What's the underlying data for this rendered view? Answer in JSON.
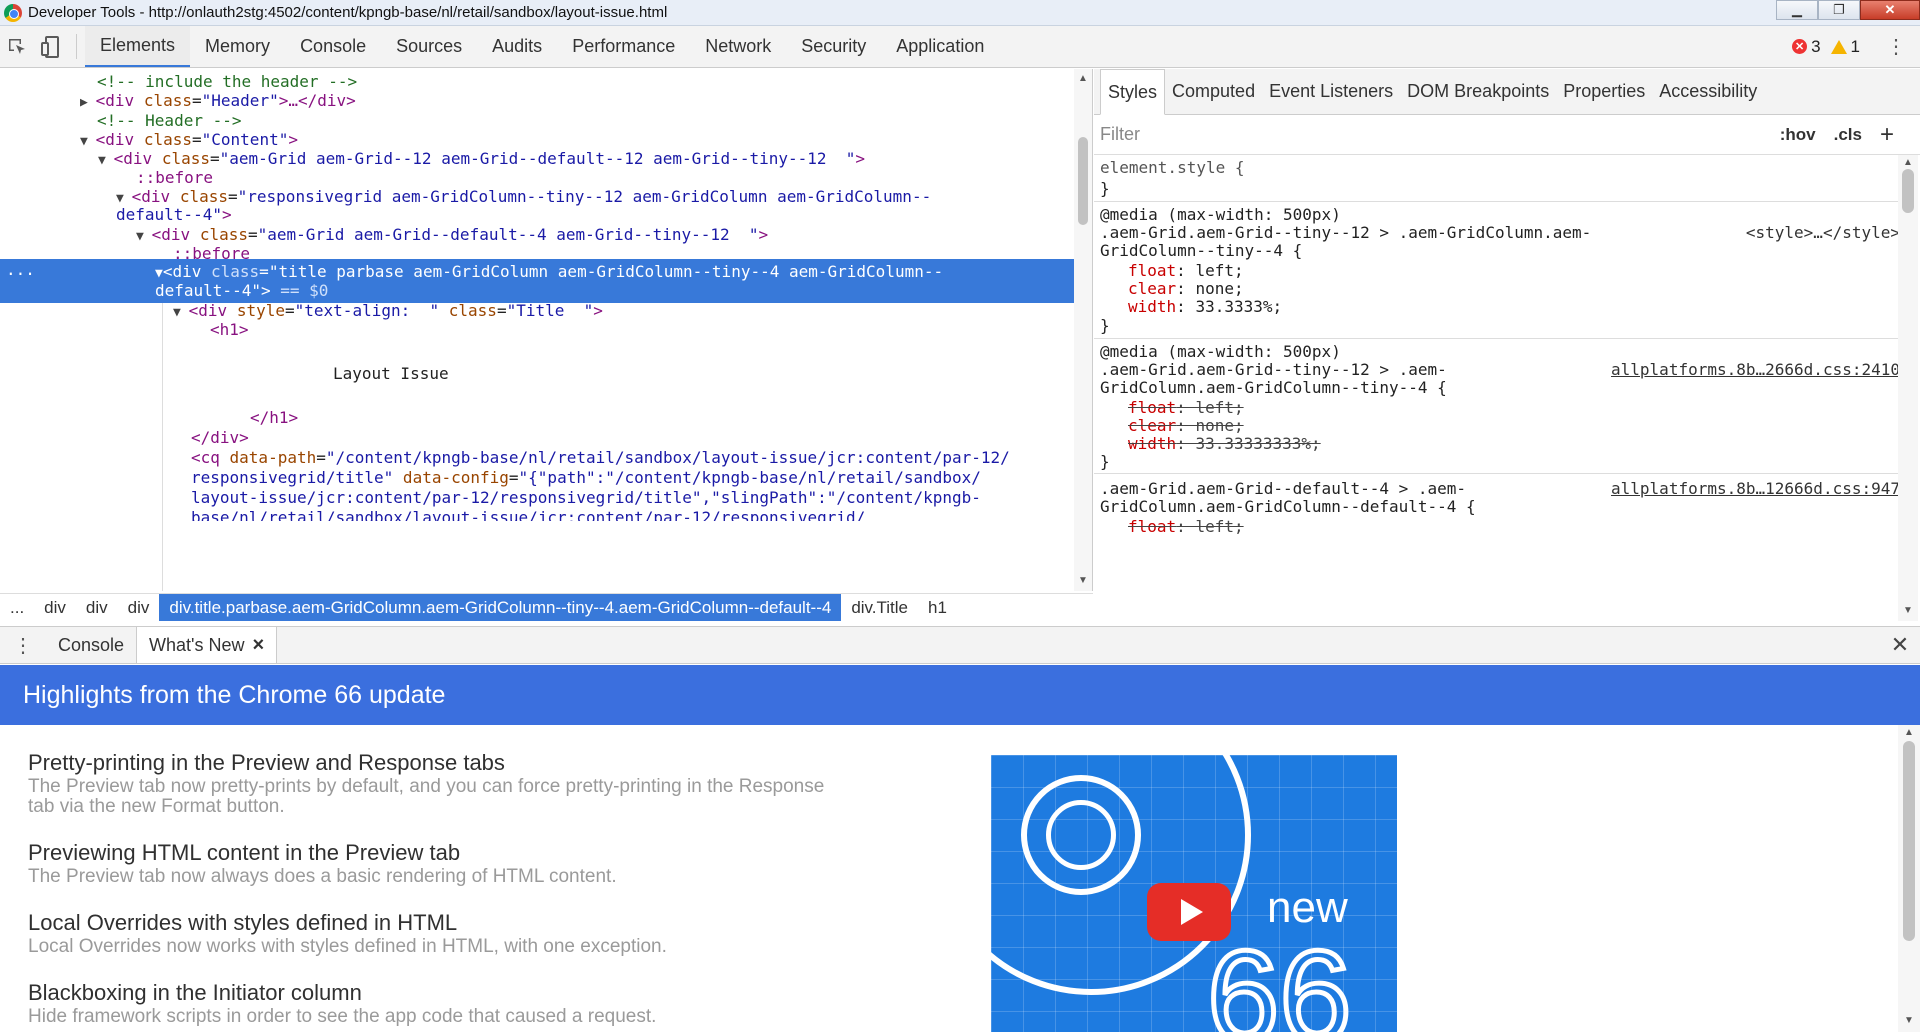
{
  "window": {
    "title": "Developer Tools - http://onlauth2stg:4502/content/kpngb-base/nl/retail/sandbox/layout-issue.html",
    "controls": {
      "minimize": "▁",
      "restore": "❐",
      "close": "✕"
    }
  },
  "toolbar": {
    "tabs": [
      "Elements",
      "Memory",
      "Console",
      "Sources",
      "Audits",
      "Performance",
      "Network",
      "Security",
      "Application"
    ],
    "active_tab": "Elements",
    "error_count": "3",
    "warning_count": "1"
  },
  "elements": {
    "lines": {
      "l0": "<!-- include the header -->",
      "l1_tag": "<div ",
      "l1_attr": "class",
      "l1_val": "\"Header\"",
      "l1_end": ">…</div>",
      "l2": "<!-- Header -->",
      "l3_tag": "<div ",
      "l3_attr": "class",
      "l3_val": "\"Content\"",
      "l3_end": ">",
      "l4_tag": "<div ",
      "l4_attr": "class",
      "l4_val": "\"aem-Grid aem-Grid--12 aem-Grid--default--12 aem-Grid--tiny--12  \"",
      "l4_end": ">",
      "l5": "::before",
      "l6_tag": "<div ",
      "l6_attr": "class",
      "l6_val": "\"responsivegrid aem-GridColumn--tiny--12 aem-GridColumn aem-GridColumn--",
      "l7_val": "default--4\"",
      "l7_end": ">",
      "l8_tag": "<div ",
      "l8_attr": "class",
      "l8_val": "\"aem-Grid aem-Grid--default--4 aem-Grid--tiny--12  \"",
      "l8_end": ">",
      "l9": "::before",
      "l10_tag": "<div ",
      "l10_attr": "class",
      "l10_val": "\"title parbase aem-GridColumn aem-GridColumn--tiny--4 aem-GridColumn--",
      "l11_val": "default--4\"",
      "l11_end": ">",
      "l11_eq": " == $0",
      "l12_tag": "<div ",
      "l12_attr": "style",
      "l12_val": "\"text-align:  \"",
      "l12_attr2": " class",
      "l12_val2": "\"Title  \"",
      "l12_end": ">",
      "l13": "<h1>",
      "l14": "Layout Issue",
      "l15": "</h1>",
      "l16": "</div>",
      "l17_tag": "<cq ",
      "l17_attr": "data-path",
      "l17_val": "\"/content/kpngb-base/nl/retail/sandbox/layout-issue/jcr:content/par-12/",
      "l18_val": "responsivegrid/title\"",
      "l18_attr": " data-config",
      "l18_val2": "\"{\"path\":\"/content/kpngb-base/nl/retail/sandbox/",
      "l19_val": "layout-issue/jcr:content/par-12/responsivegrid/title\",\"slingPath\":\"/content/kpngb-",
      "l20_val": "base/nl/retail/sandbox/layout-issue/jcr:content/par-12/responsivegrid/"
    },
    "gutter_dots": "..."
  },
  "breadcrumbs": {
    "items": [
      "...",
      "div",
      "div",
      "div",
      "div.title.parbase.aem-GridColumn.aem-GridColumn--tiny--4.aem-GridColumn--default--4",
      "div.Title",
      "h1"
    ],
    "active_index": 4
  },
  "styles": {
    "tabs": [
      "Styles",
      "Computed",
      "Event Listeners",
      "DOM Breakpoints",
      "Properties",
      "Accessibility"
    ],
    "active_tab": "Styles",
    "filter_placeholder": "Filter",
    "hov": ":hov",
    "cls": ".cls",
    "add": "+",
    "rules": {
      "r0_sel": "element.style {",
      "r0_end": "}",
      "r1_media": "@media (max-width: 500px)",
      "r1_sel1": ".aem-Grid.aem-Grid--tiny--12 > .aem-GridColumn.aem-",
      "r1_src": "<style>…</style>",
      "r1_sel2": "GridColumn--tiny--4 {",
      "r1_p1": "float",
      "r1_v1": ": left;",
      "r1_p2": "clear",
      "r1_v2": ": none;",
      "r1_p3": "width",
      "r1_v3": ": 33.3333%;",
      "r1_end": "}",
      "r2_media": "@media (max-width: 500px)",
      "r2_sel1": ".aem-Grid.aem-Grid--tiny--12 > .aem-",
      "r2_src": "allplatforms.8b…2666d.css:2410",
      "r2_sel2": "GridColumn.aem-GridColumn--tiny--4 {",
      "r2_p1": "float",
      "r2_v1": ": left;",
      "r2_p2": "clear",
      "r2_v2": ": none;",
      "r2_p3": "width",
      "r2_v3": ": 33.33333333%;",
      "r2_end": "}",
      "r3_sel1": ".aem-Grid.aem-Grid--default--4 > .aem-",
      "r3_src": "allplatforms.8b…12666d.css:947",
      "r3_sel2": "GridColumn.aem-GridColumn--default--4 {",
      "r3_p1": "float",
      "r3_v1": ": left;"
    }
  },
  "drawer": {
    "tabs": [
      "Console",
      "What's New"
    ],
    "active_tab": "What's New",
    "tab_close": "×",
    "close": "✕",
    "header": "Highlights from the Chrome 66 update",
    "items": [
      {
        "title": "Pretty-printing in the Preview and Response tabs",
        "desc1": "The Preview tab now pretty-prints by default, and you can force pretty-printing in the Response",
        "desc2": "tab via the new Format button."
      },
      {
        "title": "Previewing HTML content in the Preview tab",
        "desc1": "The Preview tab now always does a basic rendering of HTML content."
      },
      {
        "title": "Local Overrides with styles defined in HTML",
        "desc1": "Local Overrides now works with styles defined in HTML, with one exception."
      },
      {
        "title": "Blackboxing in the Initiator column",
        "desc1": "Hide framework scripts in order to see the app code that caused a request."
      }
    ],
    "video": {
      "word": "new",
      "number": "66"
    }
  },
  "colors": {
    "accent": "#3879d9",
    "header_blue": "#3b6fde",
    "tag": "#881280",
    "attr": "#994500",
    "value": "#1a1aa6",
    "comment": "#236e25",
    "css_prop": "#c80000",
    "error": "#ee3333",
    "warning": "#f5b400"
  }
}
